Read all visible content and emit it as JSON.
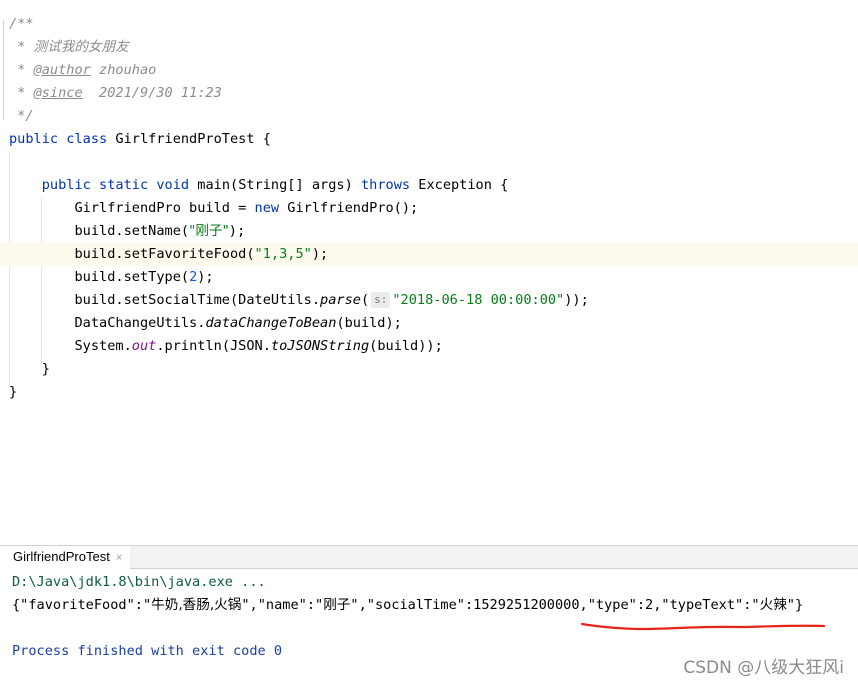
{
  "editor": {
    "javadoc_open": "/**",
    "doc_desc": "测试我的女朋友",
    "doc_star": " * ",
    "author_tag": "@author",
    "author_name": " zhouhao",
    "since_tag": "@since",
    "since_value": "  2021/9/30 11:23",
    "javadoc_close": " */",
    "kw_public": "public",
    "kw_class": "class",
    "class_name": " GirlfriendProTest {",
    "kw_static": "static",
    "kw_void": "void",
    "method_sig": " main(String[] args) ",
    "kw_throws": "throws",
    "exception": " Exception {",
    "line_build_a": "GirlfriendPro build = ",
    "kw_new": "new",
    "line_build_b": " GirlfriendPro();",
    "set_name_a": "build.setName(",
    "set_name_str": "\"刚子\"",
    "close_paren_semi": ");",
    "set_food_a": "build.setFavoriteFood(",
    "set_food_str": "\"1,3,5\"",
    "set_type_a": "build.setType(",
    "set_type_num": "2",
    "set_social_a": "build.setSocialTime(DateUtils.",
    "parse_method": "parse",
    "open_paren": "(",
    "param_hint": "s:",
    "date_str": "\"2018-06-18 00:00:00\"",
    "close_double": "));",
    "dc_a": "DataChangeUtils.",
    "dc_method": "dataChangeToBean",
    "dc_b": "(build);",
    "sys_a": "System.",
    "sys_out": "out",
    "sys_b": ".println(JSON.",
    "sys_method": "toJSONString",
    "sys_c": "(build));",
    "close_brace": "}"
  },
  "run_panel": {
    "tab_label": "GirlfriendProTest",
    "tab_close": "×"
  },
  "console": {
    "command": "D:\\Java\\jdk1.8\\bin\\java.exe ...",
    "output_a": "{\"favoriteFood\":\"",
    "output_food": "牛奶,香肠,火锅",
    "output_b": "\",\"name\":\"",
    "output_name": "刚子",
    "output_c": "\",\"socialTime\":1529251200000,\"type\":2,\"typeText\":\"",
    "output_typetext": "火辣",
    "output_d": "\"}",
    "exit_message": "Process finished with exit code 0",
    "annotation_color": "#e8231b"
  },
  "watermark": "CSDN @八级大狂风i"
}
